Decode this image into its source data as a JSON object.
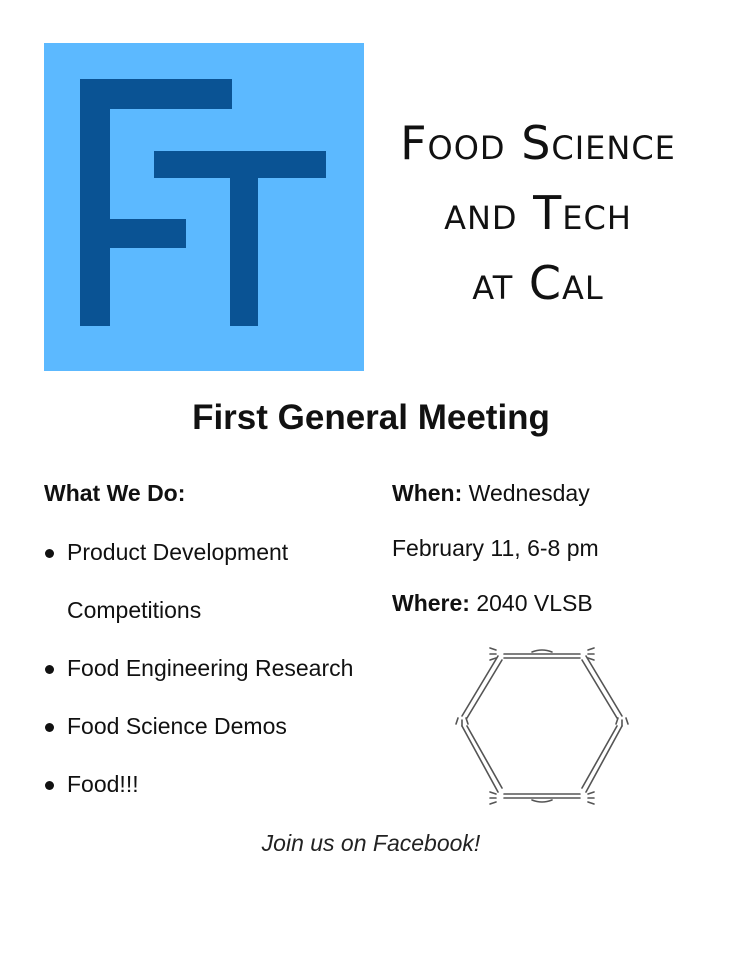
{
  "logo": {
    "letters": "FT",
    "colors": {
      "background": "#5cb9ff",
      "letter": "#0a5394"
    }
  },
  "club_name": {
    "line1": "Food Science",
    "line2": "and Tech",
    "line3": "at Cal"
  },
  "meeting_title": "First General Meeting",
  "what_we_do": {
    "heading": "What We Do:",
    "items": [
      "Product Development Competitions",
      "Food Engineering Research",
      "Food Science Demos",
      "Food!!!"
    ]
  },
  "event": {
    "when_label": "When:",
    "when_value_line1": "Wednesday",
    "when_value_line2": "February 11, 6-8 pm",
    "where_label": "Where:",
    "where_value": "2040 VLSB"
  },
  "graphic": {
    "icon": "cutlery-hexagon-icon"
  },
  "footer": {
    "facebook_note": "Join us on Facebook!"
  }
}
